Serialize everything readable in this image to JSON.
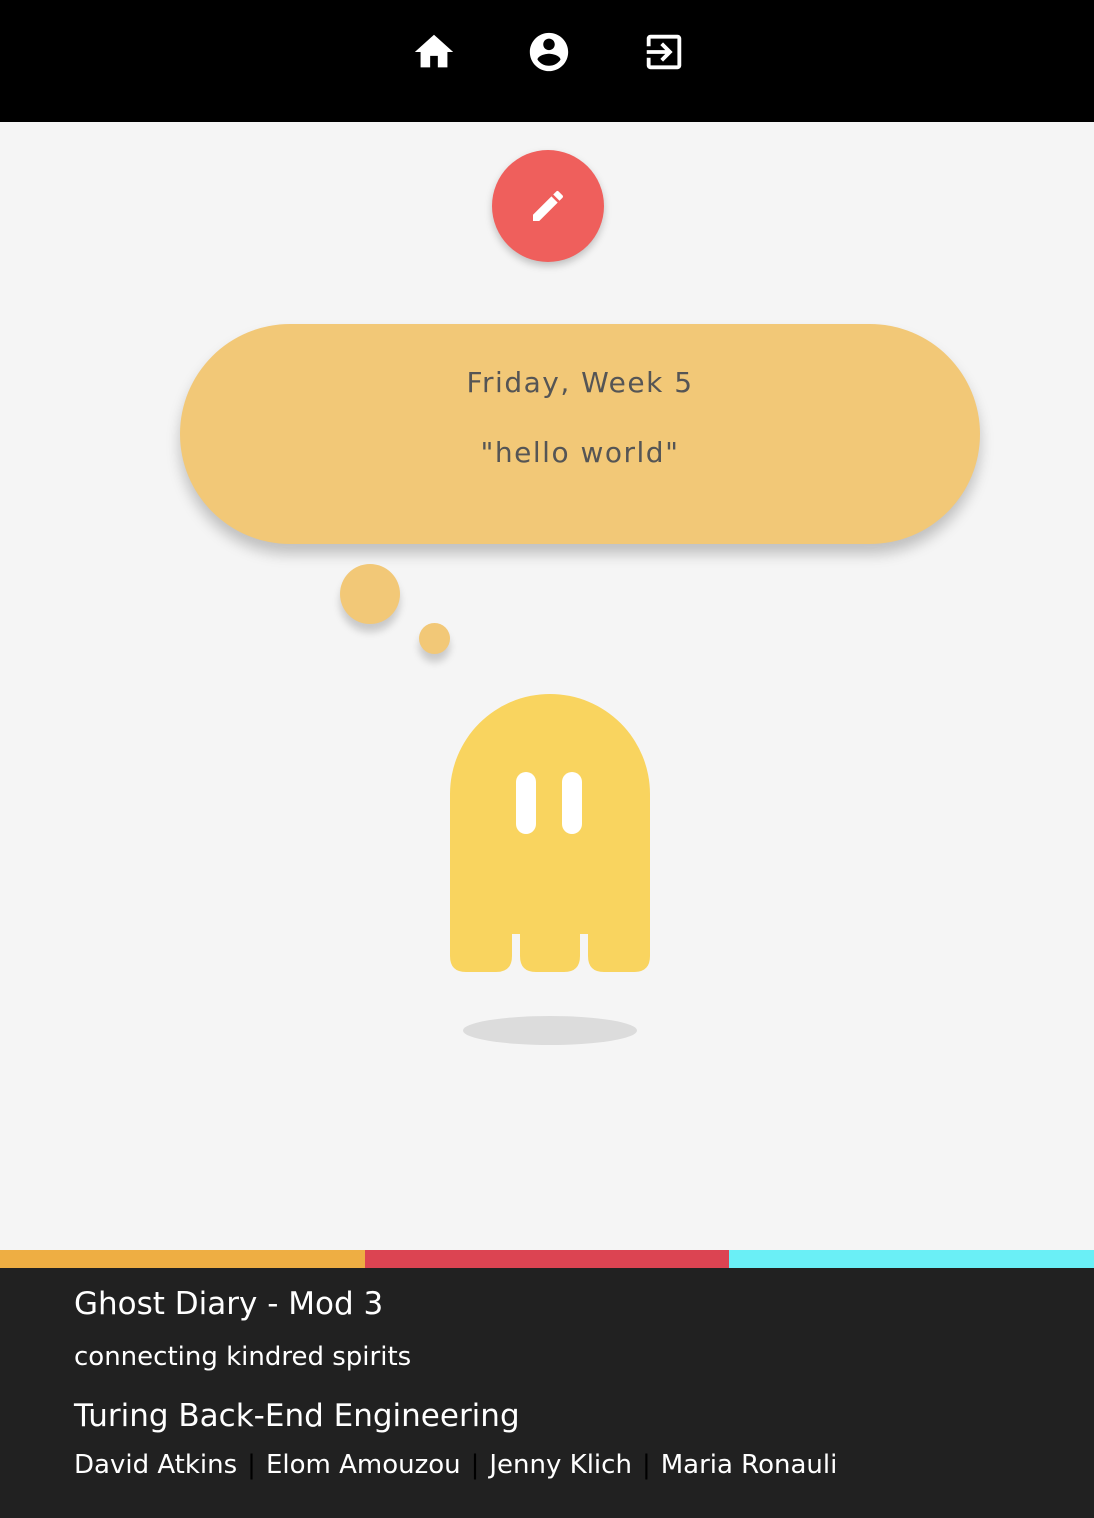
{
  "nav": {
    "items": [
      {
        "name": "home",
        "icon": "home-icon"
      },
      {
        "name": "profile",
        "icon": "account-circle-icon"
      },
      {
        "name": "logout",
        "icon": "exit-to-app-icon"
      }
    ]
  },
  "fab": {
    "icon": "pencil-icon",
    "color": "#ef5f5c"
  },
  "entry": {
    "date": "Friday, Week 5",
    "message": "\"hello world\"",
    "color": "#f2c877"
  },
  "ghost": {
    "color": "#f9d45f"
  },
  "footer": {
    "stripe_colors": [
      "#eeae43",
      "#dc4452",
      "#6aeff6"
    ],
    "title": "Ghost Diary - Mod 3",
    "tagline": "connecting kindred spirits",
    "school": "Turing Back-End Engineering",
    "authors": [
      "David Atkins",
      "Elom Amouzou",
      "Jenny Klich",
      "Maria Ronauli"
    ],
    "separator": "|"
  }
}
